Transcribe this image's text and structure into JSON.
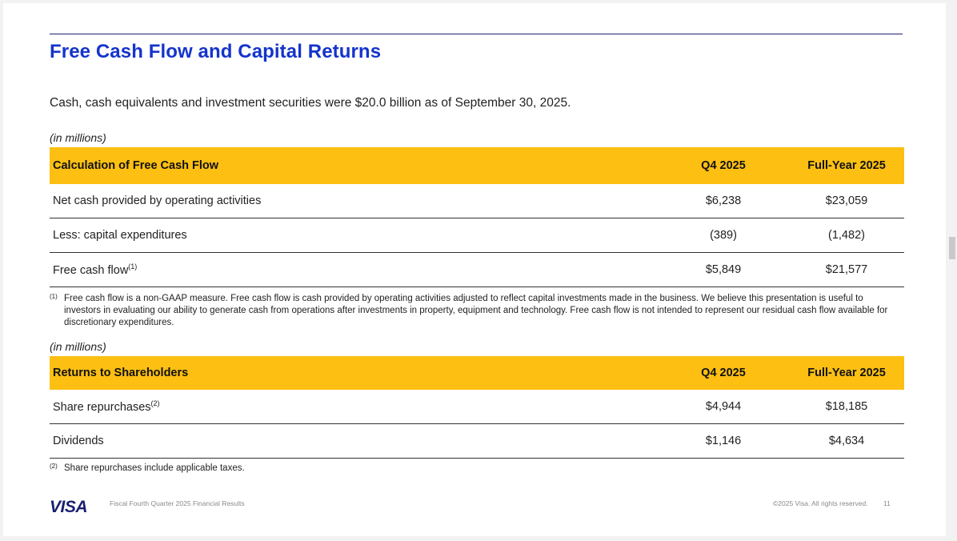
{
  "title": "Free Cash Flow and Capital Returns",
  "intro": "Cash, cash equivalents and investment securities were $20.0 billion as of September 30, 2025.",
  "units_label": "(in millions)",
  "fcf_table": {
    "header": [
      "Calculation of Free Cash Flow",
      "Q4 2025",
      "Full-Year 2025"
    ],
    "rows": [
      {
        "label": "Net cash provided by operating activities",
        "sup": "",
        "q4": "$6,238",
        "fy": "$23,059"
      },
      {
        "label": "Less: capital expenditures",
        "sup": "",
        "q4": "(389)",
        "fy": "(1,482)"
      },
      {
        "label": "Free cash flow",
        "sup": "(1)",
        "q4": "$5,849",
        "fy": "$21,577"
      }
    ]
  },
  "footnote1": {
    "mark": "(1)",
    "text": "Free cash flow is a non-GAAP measure. Free cash flow is cash provided by operating activities adjusted to reflect capital investments made in the business. We believe this presentation is useful to investors in evaluating our ability to generate cash from operations after investments in property, equipment and technology. Free cash flow is not intended to represent our residual cash flow available for discretionary expenditures."
  },
  "returns_table": {
    "header": [
      "Returns to Shareholders",
      "Q4 2025",
      "Full-Year 2025"
    ],
    "rows": [
      {
        "label": "Share repurchases",
        "sup": "(2)",
        "q4": "$4,944",
        "fy": "$18,185"
      },
      {
        "label": "Dividends",
        "sup": "",
        "q4": "$1,146",
        "fy": "$4,634"
      }
    ]
  },
  "footnote2": {
    "mark": "(2)",
    "text": "Share repurchases include applicable taxes."
  },
  "footer": {
    "logo": "VISA",
    "left": "Fiscal Fourth Quarter 2025 Financial Results",
    "right": "©2025 Visa. All rights reserved.",
    "page": "11"
  }
}
